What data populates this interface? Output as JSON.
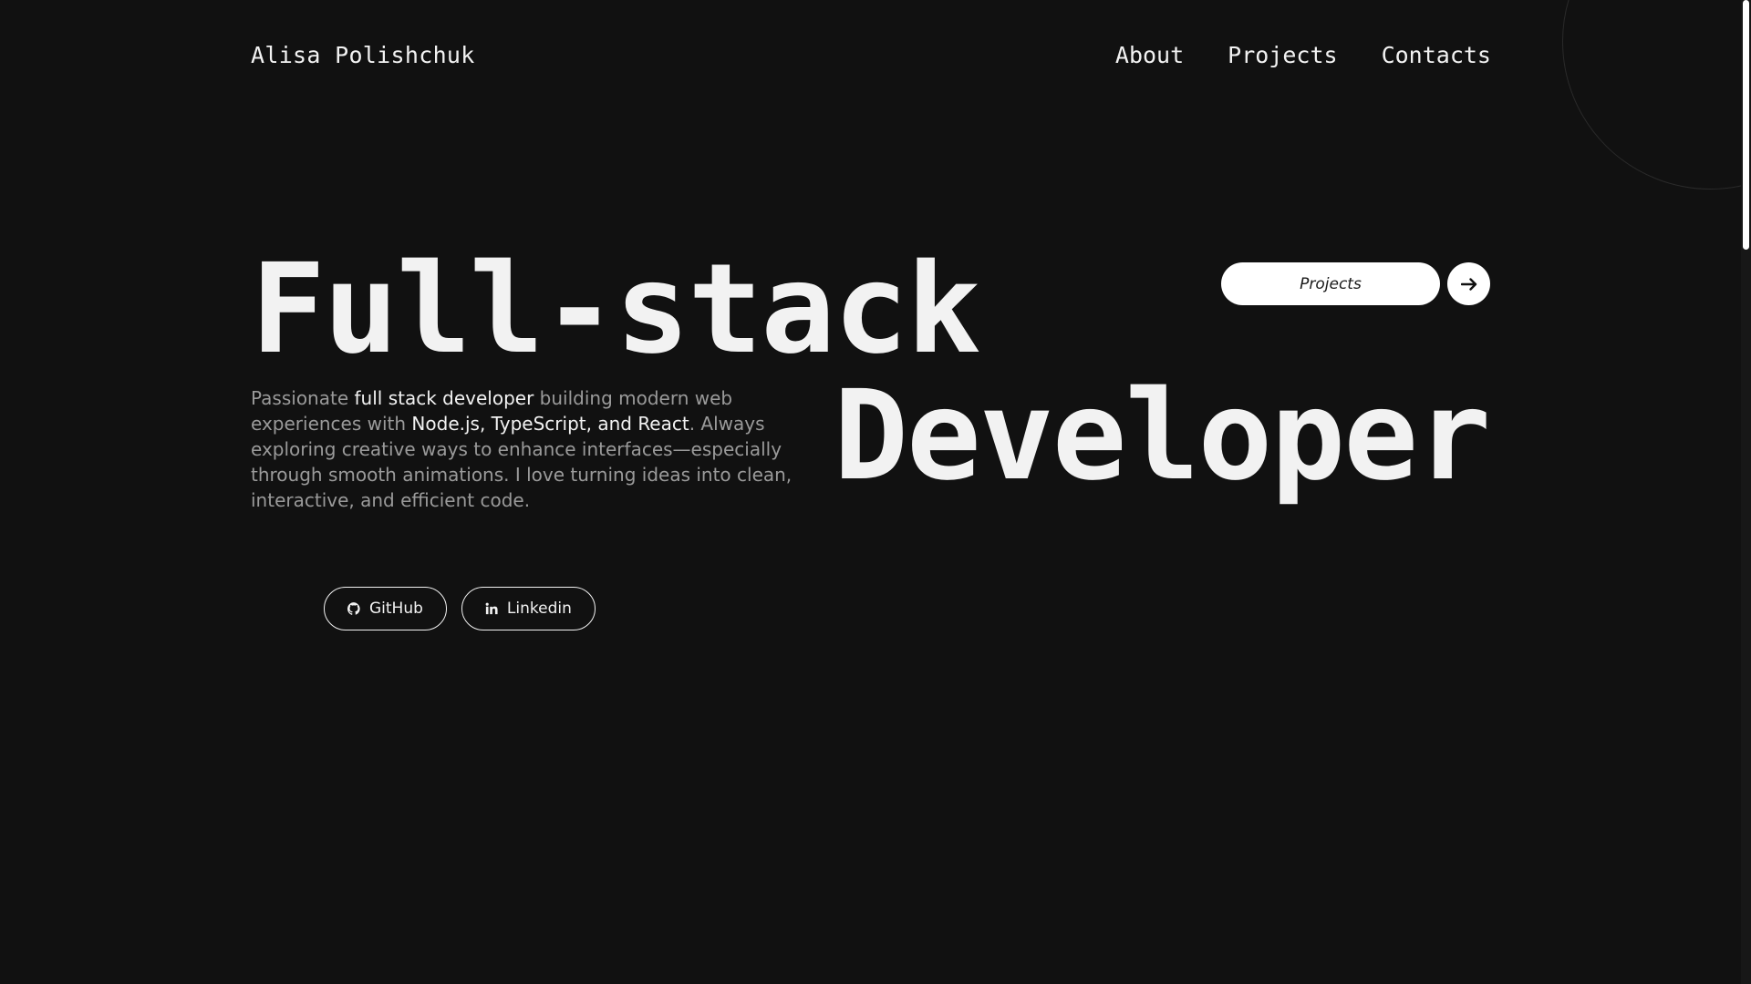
{
  "header": {
    "logo": "Alisa Polishchuk",
    "nav": [
      {
        "label": "About"
      },
      {
        "label": "Projects"
      },
      {
        "label": "Contacts"
      }
    ]
  },
  "hero": {
    "line1": "Full-stack",
    "line2": "Developer",
    "intro": {
      "p1": "Passionate ",
      "h1": "full stack developer",
      "p2": " building modern web experiences with ",
      "h2": "Node.js, TypeScript, and React",
      "p3": ". Always exploring creative ways to enhance interfaces—especially through smooth animations. I love turning ideas into clean, interactive, and efficient code."
    },
    "cta": {
      "label": "Projects",
      "icon": "arrow-right-icon"
    }
  },
  "socials": [
    {
      "label": "GitHub",
      "icon": "github-icon"
    },
    {
      "label": "Linkedin",
      "icon": "linkedin-icon"
    }
  ],
  "colors": {
    "background": "#111111",
    "text": "#f2f2f2",
    "muted_text": "#9a9a9a",
    "button_fill": "#ffffff"
  }
}
